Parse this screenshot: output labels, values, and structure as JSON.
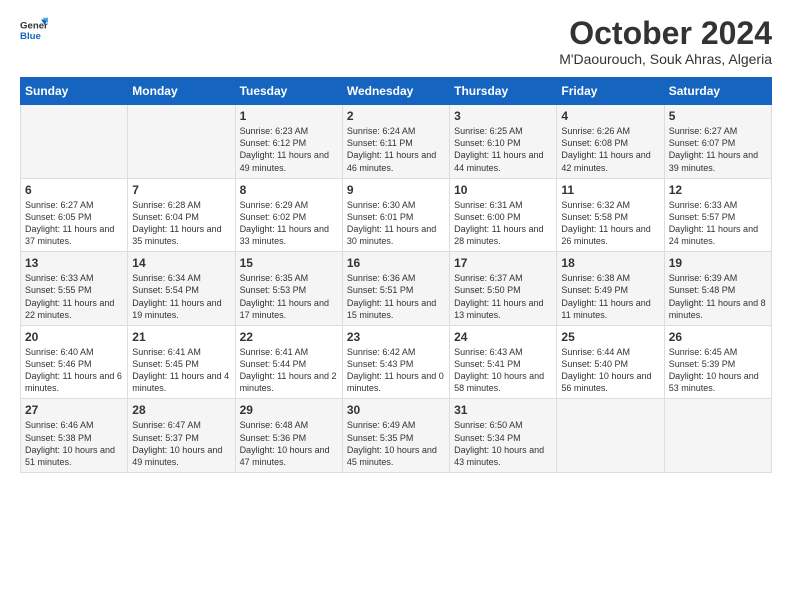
{
  "logo": {
    "line1": "General",
    "line2": "Blue"
  },
  "title": "October 2024",
  "location": "M'Daourouch, Souk Ahras, Algeria",
  "days_of_week": [
    "Sunday",
    "Monday",
    "Tuesday",
    "Wednesday",
    "Thursday",
    "Friday",
    "Saturday"
  ],
  "weeks": [
    [
      {
        "day": "",
        "content": ""
      },
      {
        "day": "",
        "content": ""
      },
      {
        "day": "1",
        "content": "Sunrise: 6:23 AM\nSunset: 6:12 PM\nDaylight: 11 hours and 49 minutes."
      },
      {
        "day": "2",
        "content": "Sunrise: 6:24 AM\nSunset: 6:11 PM\nDaylight: 11 hours and 46 minutes."
      },
      {
        "day": "3",
        "content": "Sunrise: 6:25 AM\nSunset: 6:10 PM\nDaylight: 11 hours and 44 minutes."
      },
      {
        "day": "4",
        "content": "Sunrise: 6:26 AM\nSunset: 6:08 PM\nDaylight: 11 hours and 42 minutes."
      },
      {
        "day": "5",
        "content": "Sunrise: 6:27 AM\nSunset: 6:07 PM\nDaylight: 11 hours and 39 minutes."
      }
    ],
    [
      {
        "day": "6",
        "content": "Sunrise: 6:27 AM\nSunset: 6:05 PM\nDaylight: 11 hours and 37 minutes."
      },
      {
        "day": "7",
        "content": "Sunrise: 6:28 AM\nSunset: 6:04 PM\nDaylight: 11 hours and 35 minutes."
      },
      {
        "day": "8",
        "content": "Sunrise: 6:29 AM\nSunset: 6:02 PM\nDaylight: 11 hours and 33 minutes."
      },
      {
        "day": "9",
        "content": "Sunrise: 6:30 AM\nSunset: 6:01 PM\nDaylight: 11 hours and 30 minutes."
      },
      {
        "day": "10",
        "content": "Sunrise: 6:31 AM\nSunset: 6:00 PM\nDaylight: 11 hours and 28 minutes."
      },
      {
        "day": "11",
        "content": "Sunrise: 6:32 AM\nSunset: 5:58 PM\nDaylight: 11 hours and 26 minutes."
      },
      {
        "day": "12",
        "content": "Sunrise: 6:33 AM\nSunset: 5:57 PM\nDaylight: 11 hours and 24 minutes."
      }
    ],
    [
      {
        "day": "13",
        "content": "Sunrise: 6:33 AM\nSunset: 5:55 PM\nDaylight: 11 hours and 22 minutes."
      },
      {
        "day": "14",
        "content": "Sunrise: 6:34 AM\nSunset: 5:54 PM\nDaylight: 11 hours and 19 minutes."
      },
      {
        "day": "15",
        "content": "Sunrise: 6:35 AM\nSunset: 5:53 PM\nDaylight: 11 hours and 17 minutes."
      },
      {
        "day": "16",
        "content": "Sunrise: 6:36 AM\nSunset: 5:51 PM\nDaylight: 11 hours and 15 minutes."
      },
      {
        "day": "17",
        "content": "Sunrise: 6:37 AM\nSunset: 5:50 PM\nDaylight: 11 hours and 13 minutes."
      },
      {
        "day": "18",
        "content": "Sunrise: 6:38 AM\nSunset: 5:49 PM\nDaylight: 11 hours and 11 minutes."
      },
      {
        "day": "19",
        "content": "Sunrise: 6:39 AM\nSunset: 5:48 PM\nDaylight: 11 hours and 8 minutes."
      }
    ],
    [
      {
        "day": "20",
        "content": "Sunrise: 6:40 AM\nSunset: 5:46 PM\nDaylight: 11 hours and 6 minutes."
      },
      {
        "day": "21",
        "content": "Sunrise: 6:41 AM\nSunset: 5:45 PM\nDaylight: 11 hours and 4 minutes."
      },
      {
        "day": "22",
        "content": "Sunrise: 6:41 AM\nSunset: 5:44 PM\nDaylight: 11 hours and 2 minutes."
      },
      {
        "day": "23",
        "content": "Sunrise: 6:42 AM\nSunset: 5:43 PM\nDaylight: 11 hours and 0 minutes."
      },
      {
        "day": "24",
        "content": "Sunrise: 6:43 AM\nSunset: 5:41 PM\nDaylight: 10 hours and 58 minutes."
      },
      {
        "day": "25",
        "content": "Sunrise: 6:44 AM\nSunset: 5:40 PM\nDaylight: 10 hours and 56 minutes."
      },
      {
        "day": "26",
        "content": "Sunrise: 6:45 AM\nSunset: 5:39 PM\nDaylight: 10 hours and 53 minutes."
      }
    ],
    [
      {
        "day": "27",
        "content": "Sunrise: 6:46 AM\nSunset: 5:38 PM\nDaylight: 10 hours and 51 minutes."
      },
      {
        "day": "28",
        "content": "Sunrise: 6:47 AM\nSunset: 5:37 PM\nDaylight: 10 hours and 49 minutes."
      },
      {
        "day": "29",
        "content": "Sunrise: 6:48 AM\nSunset: 5:36 PM\nDaylight: 10 hours and 47 minutes."
      },
      {
        "day": "30",
        "content": "Sunrise: 6:49 AM\nSunset: 5:35 PM\nDaylight: 10 hours and 45 minutes."
      },
      {
        "day": "31",
        "content": "Sunrise: 6:50 AM\nSunset: 5:34 PM\nDaylight: 10 hours and 43 minutes."
      },
      {
        "day": "",
        "content": ""
      },
      {
        "day": "",
        "content": ""
      }
    ]
  ]
}
